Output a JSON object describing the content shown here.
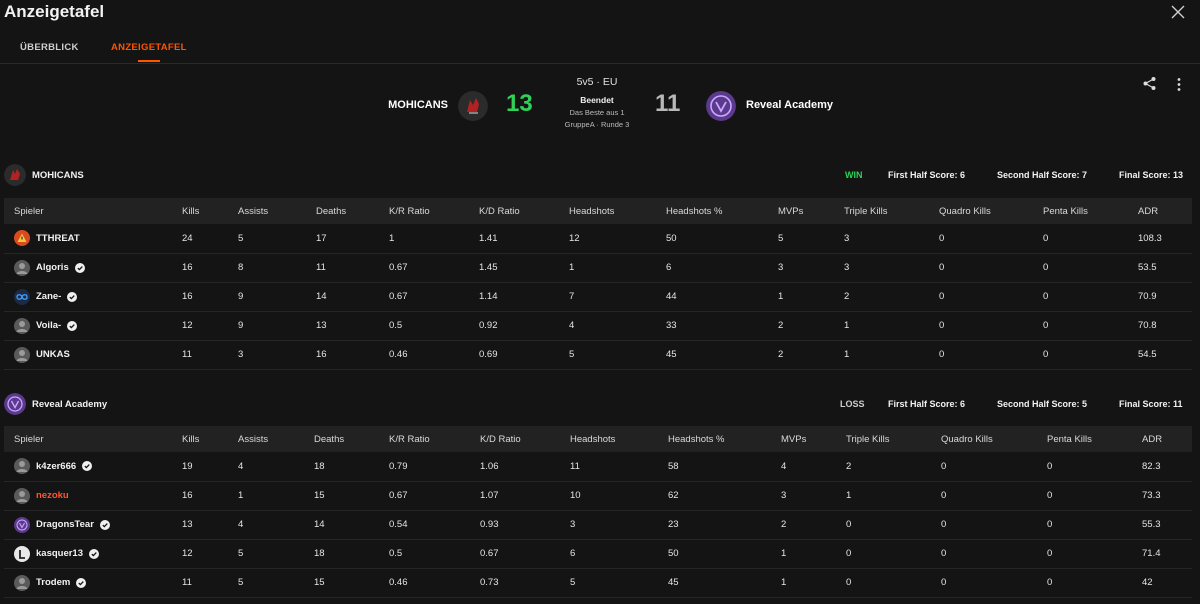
{
  "window": {
    "title": "Anzeigetafel"
  },
  "tabs": [
    {
      "label": "ÜBERBLICK",
      "active": false
    },
    {
      "label": "ANZEIGETAFEL",
      "active": true
    }
  ],
  "match": {
    "mode": "5v5 · EU",
    "status": "Beendet",
    "format": "Das Beste aus 1",
    "round": "GruppeA · Runde 3",
    "team_a": {
      "name": "MOHICANS",
      "score": "13"
    },
    "team_b": {
      "name": "Reveal Academy",
      "score": "11"
    }
  },
  "colors": {
    "accent": "#ff5500",
    "win": "#2fd158",
    "name_highlight": "#ff5533"
  },
  "columns": [
    "Spieler",
    "Kills",
    "Assists",
    "Deaths",
    "K/R Ratio",
    "K/D Ratio",
    "Headshots",
    "Headshots %",
    "MVPs",
    "Triple Kills",
    "Quadro Kills",
    "Penta Kills",
    "ADR"
  ],
  "teams": [
    {
      "name": "MOHICANS",
      "result": "WIN",
      "first_half": "First Half Score: 6",
      "second_half": "Second Half Score: 7",
      "final": "Final Score: 13",
      "players": [
        {
          "name": "TTHREAT",
          "verified": false,
          "avatar_icon": "warning-triangle-icon",
          "stats": [
            "24",
            "5",
            "17",
            "1",
            "1.41",
            "12",
            "50",
            "5",
            "3",
            "0",
            "0",
            "108.3"
          ]
        },
        {
          "name": "Algoris",
          "verified": true,
          "avatar_icon": "player-avatar",
          "stats": [
            "16",
            "8",
            "11",
            "0.67",
            "1.45",
            "1",
            "6",
            "3",
            "3",
            "0",
            "0",
            "53.5"
          ]
        },
        {
          "name": "Zane-",
          "verified": true,
          "avatar_icon": "infinity-icon",
          "stats": [
            "16",
            "9",
            "14",
            "0.67",
            "1.14",
            "7",
            "44",
            "1",
            "2",
            "0",
            "0",
            "70.9"
          ]
        },
        {
          "name": "Voila-",
          "verified": true,
          "avatar_icon": "player-avatar",
          "stats": [
            "12",
            "9",
            "13",
            "0.5",
            "0.92",
            "4",
            "33",
            "2",
            "1",
            "0",
            "0",
            "70.8"
          ]
        },
        {
          "name": "UNKAS",
          "verified": false,
          "avatar_icon": "player-avatar",
          "stats": [
            "11",
            "3",
            "16",
            "0.46",
            "0.69",
            "5",
            "45",
            "2",
            "1",
            "0",
            "0",
            "54.5"
          ]
        }
      ]
    },
    {
      "name": "Reveal Academy",
      "result": "LOSS",
      "first_half": "First Half Score: 6",
      "second_half": "Second Half Score: 5",
      "final": "Final Score: 11",
      "players": [
        {
          "name": "k4zer666",
          "verified": true,
          "avatar_icon": "player-avatar",
          "stats": [
            "19",
            "4",
            "18",
            "0.79",
            "1.06",
            "11",
            "58",
            "4",
            "2",
            "0",
            "0",
            "82.3"
          ]
        },
        {
          "name": "nezoku",
          "verified": false,
          "highlight": true,
          "avatar_icon": "player-avatar",
          "stats": [
            "16",
            "1",
            "15",
            "0.67",
            "1.07",
            "10",
            "62",
            "3",
            "1",
            "0",
            "0",
            "73.3"
          ]
        },
        {
          "name": "DragonsTear",
          "verified": true,
          "avatar_icon": "reveal-logo-icon",
          "stats": [
            "13",
            "4",
            "14",
            "0.54",
            "0.93",
            "3",
            "23",
            "2",
            "0",
            "0",
            "0",
            "55.3"
          ]
        },
        {
          "name": "kasquer13",
          "verified": true,
          "avatar_icon": "letter-l-icon",
          "stats": [
            "12",
            "5",
            "18",
            "0.5",
            "0.67",
            "6",
            "50",
            "1",
            "0",
            "0",
            "0",
            "71.4"
          ]
        },
        {
          "name": "Trodem",
          "verified": true,
          "avatar_icon": "player-avatar",
          "stats": [
            "11",
            "5",
            "15",
            "0.46",
            "0.73",
            "5",
            "45",
            "1",
            "0",
            "0",
            "0",
            "42"
          ]
        }
      ]
    }
  ]
}
